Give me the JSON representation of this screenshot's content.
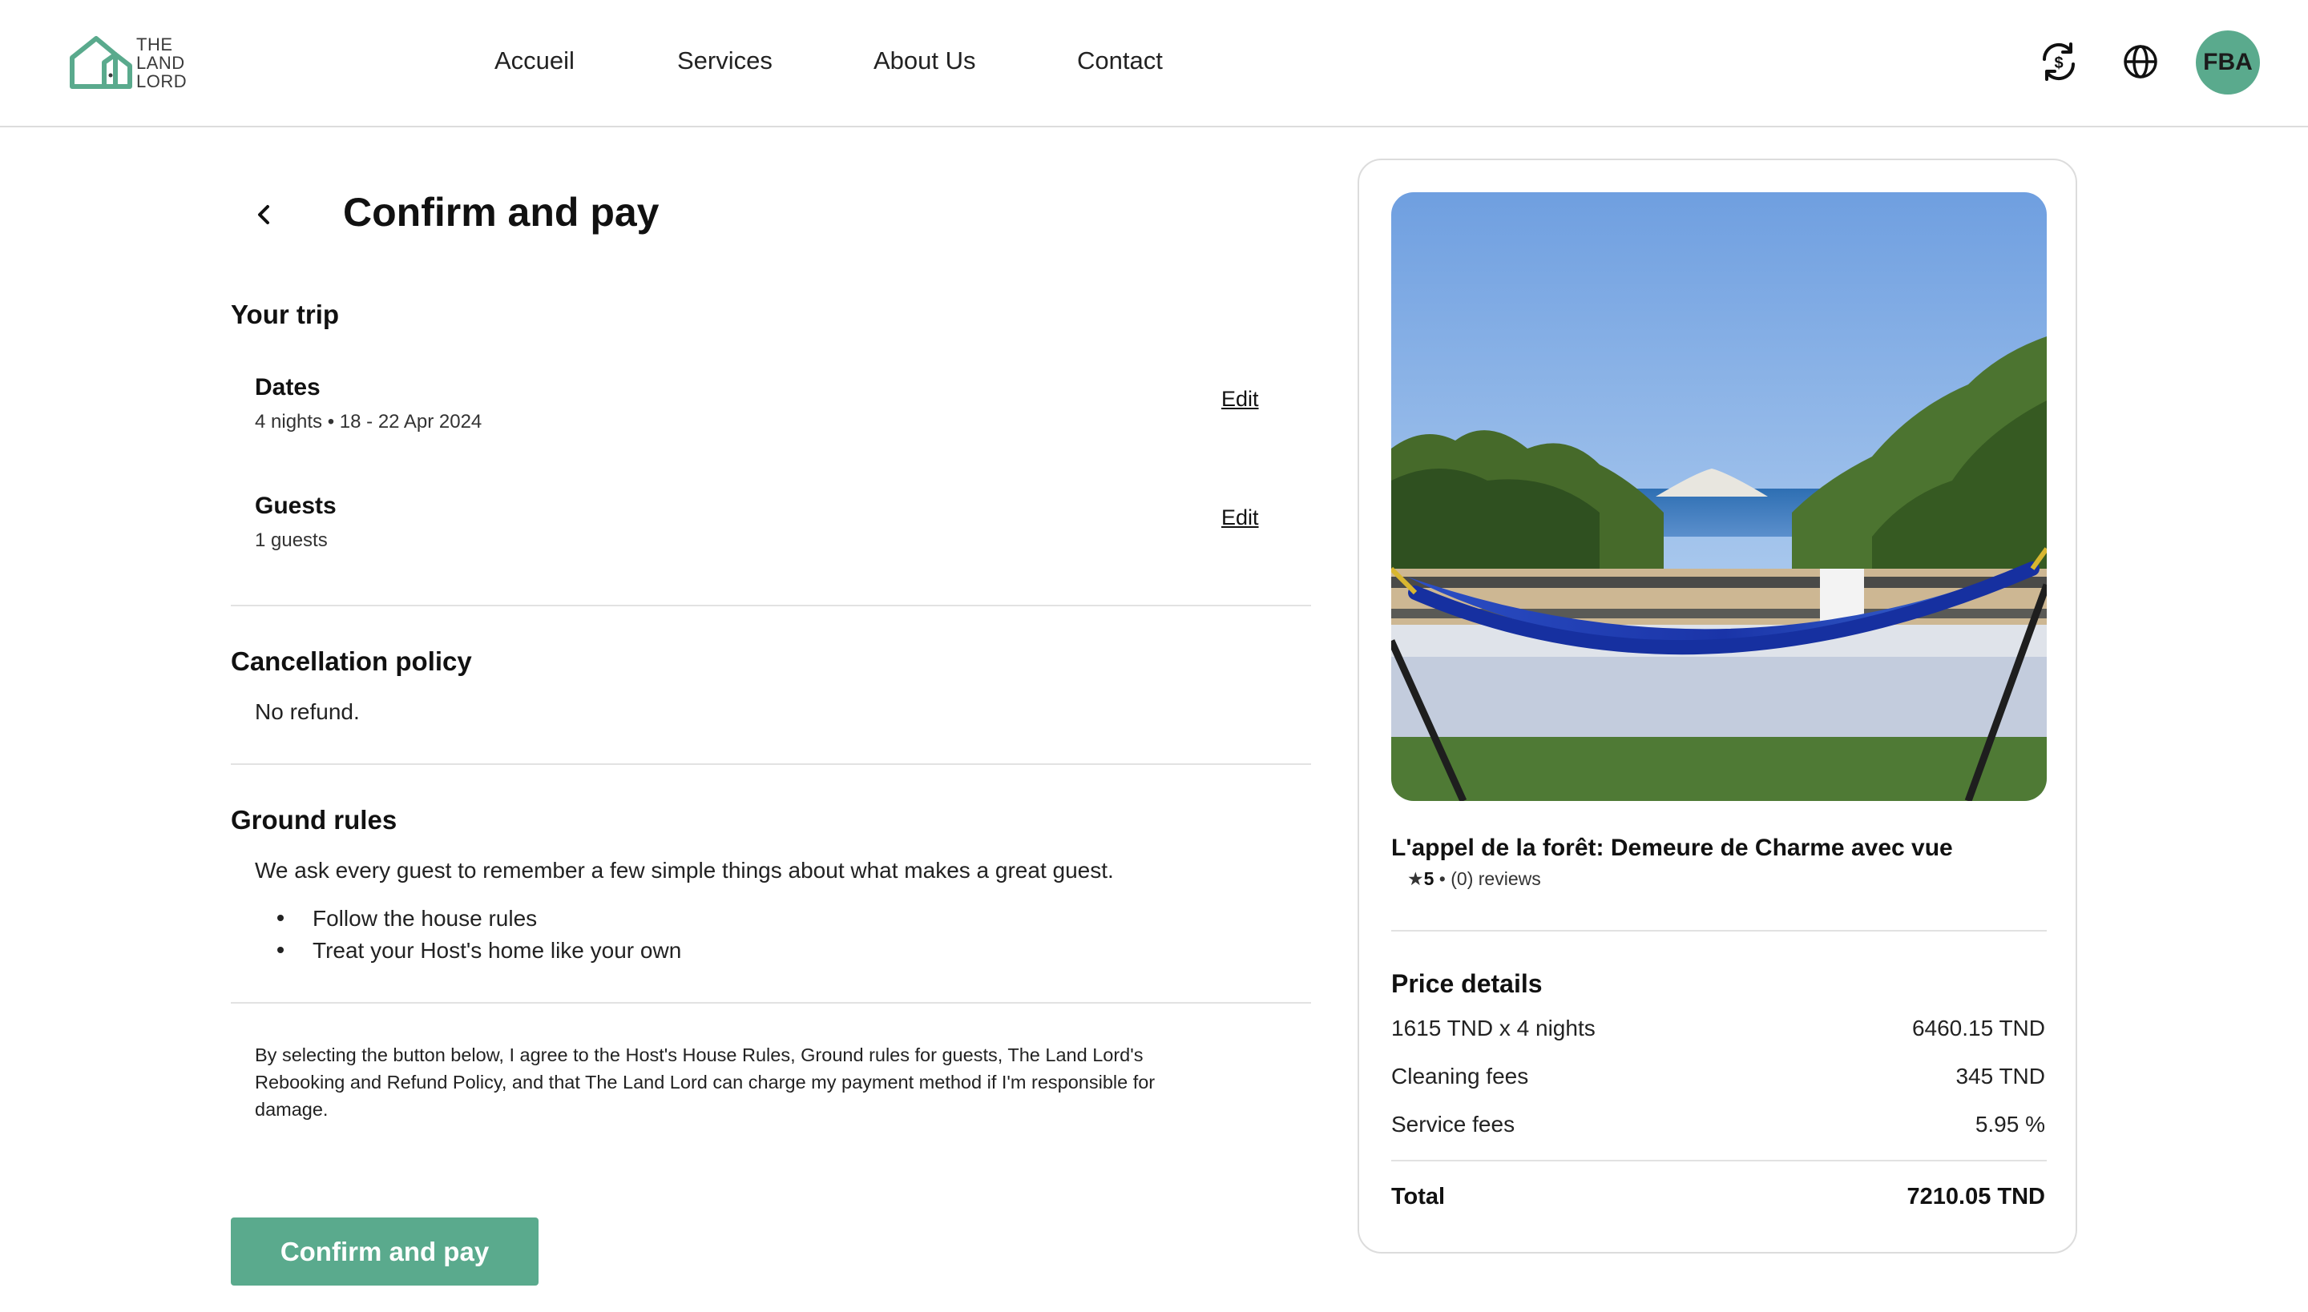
{
  "brand": {
    "logo_lines": [
      "THE",
      "LAND",
      "LORD"
    ],
    "accent": "#5aaa8d"
  },
  "nav": {
    "items": [
      "Accueil",
      "Services",
      "About Us",
      "Contact"
    ]
  },
  "header_icons": [
    "currency-exchange-icon",
    "globe-icon"
  ],
  "user": {
    "initials": "FBA"
  },
  "page": {
    "title": "Confirm and pay",
    "trip": {
      "heading": "Your trip",
      "dates_label": "Dates",
      "dates_value": "4 nights • 18 - 22 Apr 2024",
      "guests_label": "Guests",
      "guests_value": "1 guests",
      "edit_label": "Edit"
    },
    "cancellation": {
      "heading": "Cancellation policy",
      "text": "No refund."
    },
    "ground_rules": {
      "heading": "Ground rules",
      "intro": "We ask every guest to remember a few simple things about what makes a great guest.",
      "rules": [
        "Follow the house rules",
        "Treat your Host's home like your own"
      ]
    },
    "legal": "By selecting the button below, I agree to the Host's House Rules, Ground rules for guests, The Land Lord's Rebooking and Refund Policy, and that The Land Lord can charge my payment method if I'm responsible for damage.",
    "confirm_button": "Confirm and pay"
  },
  "listing": {
    "title": "L'appel de la forêt: Demeure de Charme avec vue",
    "rating": "5",
    "reviews": " • (0) reviews",
    "price_details": {
      "heading": "Price details",
      "rows": [
        {
          "label": "1615 TND x 4 nights",
          "value": "6460.15 TND"
        },
        {
          "label": "Cleaning fees",
          "value": "345 TND"
        },
        {
          "label": "Service fees",
          "value": "5.95 %"
        }
      ],
      "total_label": "Total",
      "total_value": "7210.05 TND"
    }
  }
}
